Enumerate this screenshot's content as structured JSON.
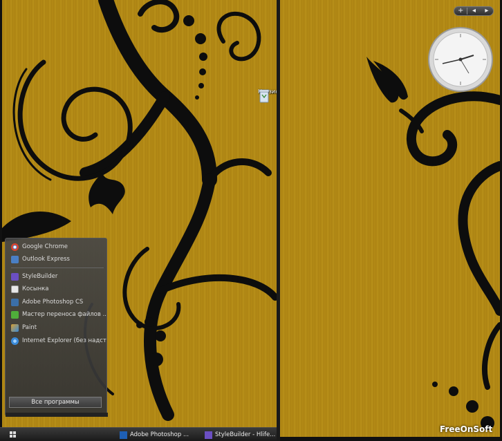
{
  "desktop": {
    "recycle_bin_label": "Корзина"
  },
  "gadgets": {
    "add_symbol": "+",
    "prev_symbol": "◂",
    "next_symbol": "▸"
  },
  "start_menu": {
    "pinned": [
      {
        "label": "Google Chrome",
        "icon": "chrome-icon",
        "color": "#d9442c"
      },
      {
        "label": "Outlook Express",
        "icon": "outlook-icon",
        "color": "#4a7fc4"
      }
    ],
    "recent": [
      {
        "label": "StyleBuilder",
        "icon": "stylebuilder-icon",
        "color": "#6b4fc2"
      },
      {
        "label": "Косынка",
        "icon": "solitaire-icon",
        "color": "#e8e8e8"
      },
      {
        "label": "Adobe Photoshop CS",
        "icon": "photoshop-icon",
        "color": "#3b6fa8"
      },
      {
        "label": "Мастер переноса файлов ...",
        "icon": "transfer-wizard-icon",
        "color": "#4fae3a"
      },
      {
        "label": "Paint",
        "icon": "paint-icon",
        "color": "#d8a030"
      },
      {
        "label": "Internet Explorer (без надст...",
        "icon": "ie-icon",
        "color": "#3a8ad8"
      }
    ],
    "all_programs_label": "Все программы"
  },
  "taskbar": {
    "items": [
      {
        "label": "Adobe Photoshop ...",
        "icon": "photoshop-icon",
        "color": "#1e5fb4"
      },
      {
        "label": "StyleBuilder - Hlife...",
        "icon": "stylebuilder-icon",
        "color": "#6b4fc2"
      }
    ]
  },
  "watermark": "FreeOnSoft",
  "colors": {
    "wallpaper": "#b48a16",
    "swirl": "#0d0d0d"
  }
}
